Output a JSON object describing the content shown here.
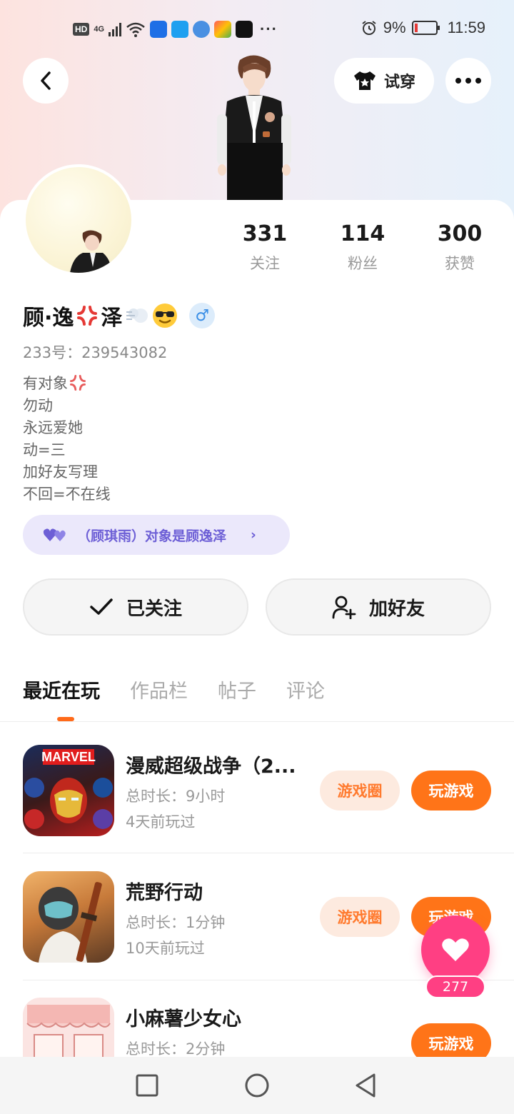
{
  "status_bar": {
    "hd": "HD",
    "network": "4G",
    "alarm_icon": "alarm-icon",
    "battery": "9%",
    "time": "11:59",
    "battery_color": "#e53935"
  },
  "header": {
    "back_icon": "chevron-left-icon",
    "tryon_label": "试穿",
    "tryon_icon": "shirt-icon",
    "more_icon": "more-dots-icon"
  },
  "profile": {
    "stats": [
      {
        "value": "331",
        "label": "关注"
      },
      {
        "value": "114",
        "label": "粉丝"
      },
      {
        "value": "300",
        "label": "获赞"
      }
    ],
    "name_part1": "顾·逸",
    "name_part2": "泽",
    "gender": "♂",
    "id_line": "233号：239543082",
    "bio": [
      "有对象",
      "勿动",
      "永远爱她",
      "动=三",
      "加好友写理",
      "不回=不在线"
    ],
    "couple_text": "（顾琪雨）对象是顾逸泽",
    "couple_icon": "hearts-icon"
  },
  "actions": {
    "follow_label": "已关注",
    "add_friend_label": "加好友"
  },
  "tabs": [
    "最近在玩",
    "作品栏",
    "帖子",
    "评论"
  ],
  "games": [
    {
      "name": "漫威超级战争（2...",
      "duration": "总时长：9小时",
      "last_played": "4天前玩过",
      "circle_label": "游戏圈",
      "play_label": "玩游戏"
    },
    {
      "name": "荒野行动",
      "duration": "总时长：1分钟",
      "last_played": "10天前玩过",
      "circle_label": "游戏圈",
      "play_label": "玩游戏"
    },
    {
      "name": "小麻薯少女心",
      "duration": "总时长：2分钟",
      "last_played": "",
      "circle_label": "",
      "play_label": "玩游戏"
    }
  ],
  "fab": {
    "count": "277",
    "icon": "heart-icon"
  },
  "colors": {
    "accent": "#ff7418",
    "pink": "#ff3f83",
    "purple": "#6d5fd6"
  }
}
